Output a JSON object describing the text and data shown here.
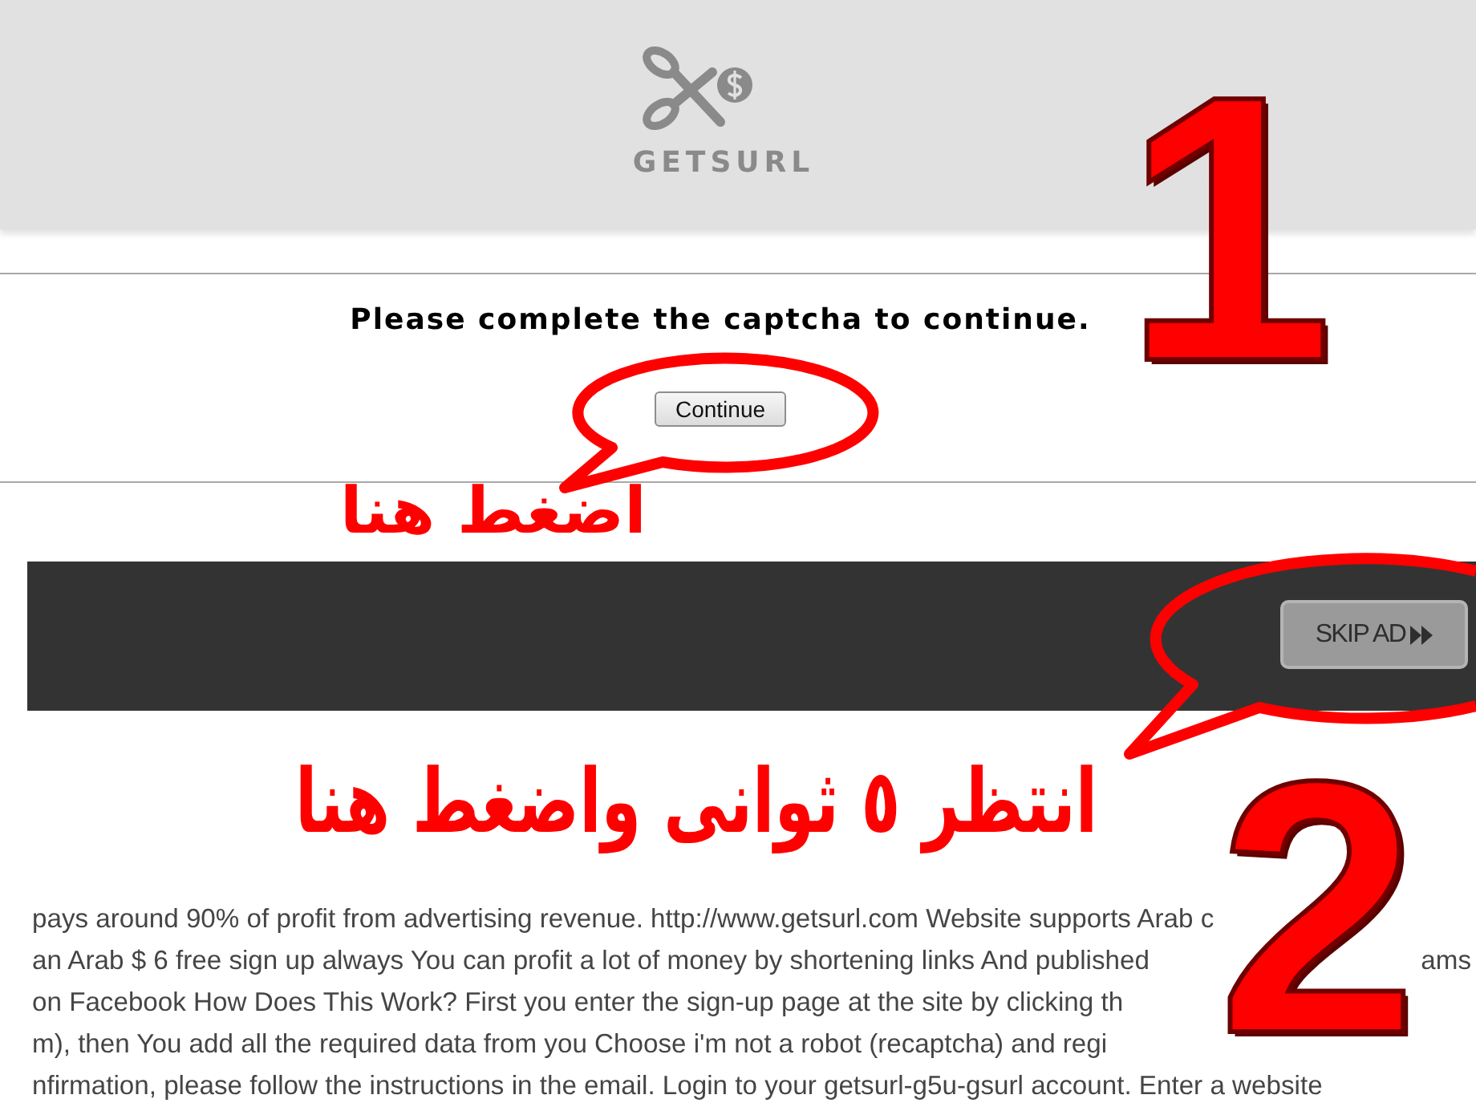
{
  "header": {
    "logo_text": "GETSURL"
  },
  "captcha": {
    "message": "Please complete the captcha to continue.",
    "button": "Continue"
  },
  "ad_bar": {
    "skip_button": "SKIP AD"
  },
  "article": {
    "lines": [
      {
        "text": "pays around 90% of profit from advertising revenue. http://www.getsurl.com Website supports Arab c"
      },
      {
        "text": "an Arab $ 6 free sign up always You can profit a lot of money by shortening links And published",
        "tail": "ams"
      },
      {
        "text": "on Facebook How Does This Work? First you enter the sign-up page at the site by clicking th"
      },
      {
        "text": "m), then You add all the required data from you Choose i'm not a robot (recaptcha) and regi"
      },
      {
        "text": "nfirmation, please follow the instructions in the email. Login to your getsurl-g5u-gsurl account. Enter a website"
      }
    ]
  },
  "annotations": [
    {
      "number": "1",
      "hint": "اضغط هنا"
    },
    {
      "number": "2",
      "hint": "انتظر ٥ ثوانى واضغط هنا"
    }
  ]
}
